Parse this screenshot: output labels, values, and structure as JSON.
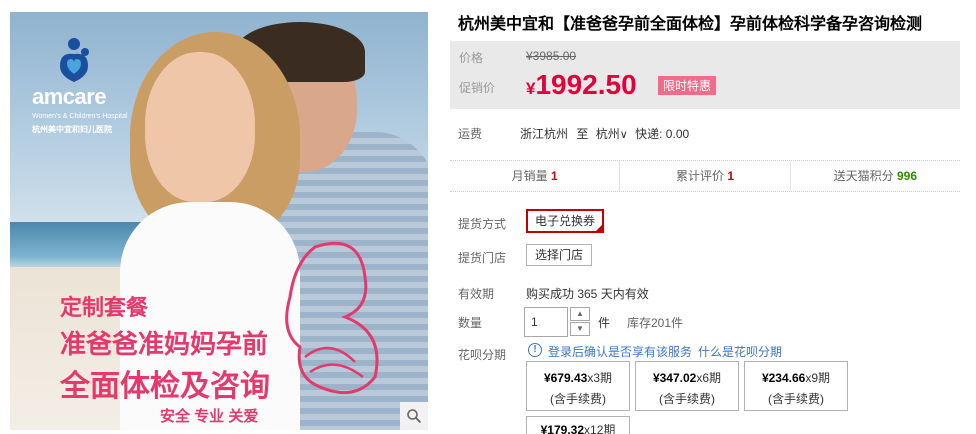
{
  "image": {
    "logo_name": "amcare",
    "logo_sub": "Women's & Children's Hospital",
    "logo_cn": "杭州美中宜和妇儿医院",
    "promo_line1": "定制套餐",
    "promo_line2": "准爸爸准妈妈孕前",
    "promo_line3": "全面体检及咨询",
    "promo_line4": "安全 专业 关爱",
    "zoom_icon": "magnifier-icon"
  },
  "product": {
    "title": "杭州美中宜和【准爸爸孕前全面体检】孕前体检科学备孕咨询检测"
  },
  "price": {
    "original_label": "价格",
    "original_value": "¥3985.00",
    "promo_label": "促销价",
    "currency": "¥",
    "promo_value": "1992.50",
    "badge": "限时特惠"
  },
  "shipping": {
    "label": "运费",
    "from": "浙江杭州",
    "to_word": "至",
    "dest": "杭州",
    "express": "快递: 0.00"
  },
  "stats": [
    {
      "label": "月销量",
      "value": "1"
    },
    {
      "label": "累计评价",
      "value": "1"
    },
    {
      "label": "送天猫积分",
      "value": "996"
    }
  ],
  "delivery": {
    "label": "提货方式",
    "option": "电子兑换券"
  },
  "store": {
    "label": "提货门店",
    "button": "选择门店"
  },
  "validity": {
    "label": "有效期",
    "value": "购买成功 365 天内有效"
  },
  "quantity": {
    "label": "数量",
    "value": "1",
    "unit": "件",
    "stock": "库存201件"
  },
  "huabei": {
    "label": "花呗分期",
    "note": "登录后确认是否享有该服务",
    "link": "什么是花呗分期",
    "plans": [
      {
        "amount": "¥679.43",
        "periods": "x3期",
        "fee": "(含手续费)"
      },
      {
        "amount": "¥347.02",
        "periods": "x6期",
        "fee": "(含手续费)"
      },
      {
        "amount": "¥234.66",
        "periods": "x9期",
        "fee": "(含手续费)"
      },
      {
        "amount": "¥179.32",
        "periods": "x12期",
        "fee": ""
      }
    ]
  },
  "colors": {
    "accent_red": "#c40000",
    "promo_price": "#e4003a",
    "badge_pink": "#f26c8a",
    "link_blue": "#3c76c2",
    "points_green": "#338800"
  }
}
